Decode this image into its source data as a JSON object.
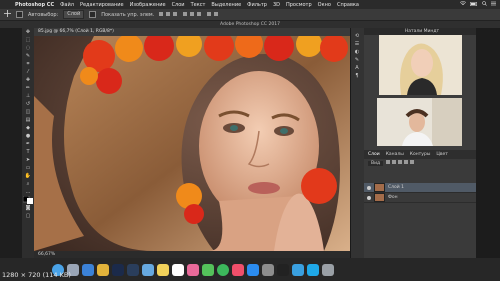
{
  "menubar": {
    "app_name": "Photoshop CC",
    "items": [
      "Файл",
      "Редактирование",
      "Изображение",
      "Слои",
      "Текст",
      "Выделение",
      "Фильтр",
      "3D",
      "Просмотр",
      "Окно",
      "Справка"
    ]
  },
  "options_bar": {
    "autoselect_label": "Автовыбор:",
    "layer_select": "Слой",
    "show_controls_label": "Показать упр. элем."
  },
  "window_title": "Adobe Photoshop CC 2017",
  "document_tab": "85.jpg @ 66,7% (Слой 1, RGB/8*)",
  "status": {
    "zoom": "66,67%"
  },
  "webcam": {
    "title": "Натали Миндт"
  },
  "layers_panel": {
    "tabs": [
      "Слои",
      "Каналы",
      "Контуры",
      "Цвет"
    ],
    "search_placeholder": "Вид",
    "layers": [
      {
        "name": "Слой 1",
        "selected": true
      },
      {
        "name": "Фон",
        "selected": false
      }
    ]
  },
  "dock": {
    "icons": [
      "finder-icon",
      "launchpad-icon",
      "safari-icon",
      "chrome-icon",
      "photoshop-icon",
      "lightroom-icon",
      "mail-icon",
      "notes-icon",
      "calendar-icon",
      "photos-icon",
      "messages-icon",
      "facetime-icon",
      "music-icon",
      "appstore-icon",
      "preferences-icon",
      "terminal-icon",
      "telegram-icon",
      "skype-icon",
      "trash-icon"
    ],
    "colors": [
      "#4aa3e8",
      "#9aa6b8",
      "#3b82d8",
      "#e2b33b",
      "#1b2a4a",
      "#2a3e5c",
      "#67a9e0",
      "#f2d25b",
      "#ffffff",
      "#e96a9a",
      "#54c25b",
      "#3cb85c",
      "#f04f6b",
      "#2b8cf0",
      "#8d8d8d",
      "#222222",
      "#3aa0e0",
      "#1fa8e8",
      "#9aa0a6"
    ]
  },
  "caption": "1280 × 720 (114 KB)",
  "colors": {
    "accent": "#505a66",
    "background": "#1e1e1e"
  }
}
